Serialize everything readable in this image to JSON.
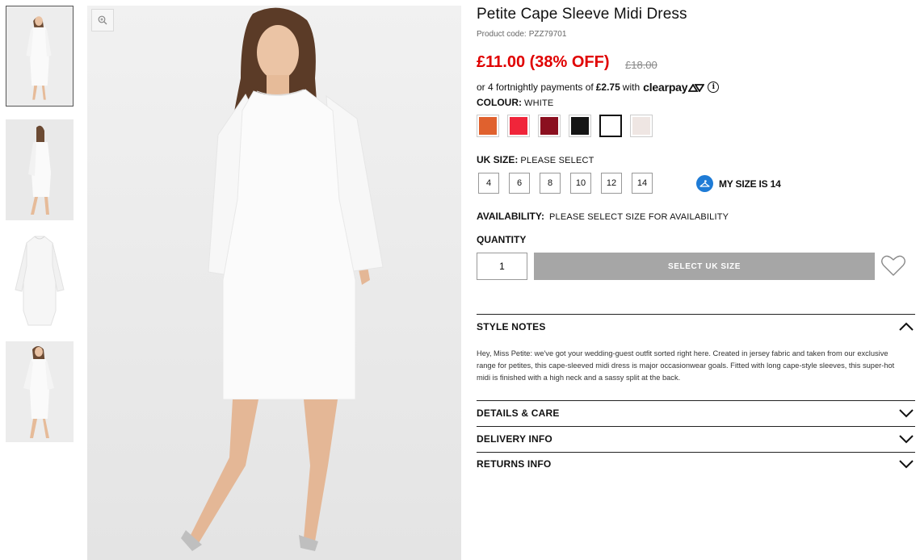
{
  "gallery": {
    "thumbnails": [
      {
        "label": "front view"
      },
      {
        "label": "side view"
      },
      {
        "label": "flat lay"
      },
      {
        "label": "full length"
      }
    ],
    "zoom_icon": "zoom-icon"
  },
  "product": {
    "title": "Petite Cape Sleeve Midi Dress",
    "code_label": "Product code:",
    "code_value": "PZZ79701",
    "price": "£11.00 (38% OFF)",
    "was_price": "£18.00",
    "clearpay": {
      "prefix": "or 4 fortnightly payments of",
      "amount": "£2.75",
      "suffix": "with",
      "logo_text": "clearpay",
      "info_icon": "info-icon"
    },
    "colour": {
      "label": "COLOUR:",
      "value": "WHITE",
      "swatches": [
        {
          "name": "orange",
          "color": "#e0612e"
        },
        {
          "name": "red",
          "color": "#f0253a"
        },
        {
          "name": "burgundy",
          "color": "#8b0f1f"
        },
        {
          "name": "black",
          "color": "#151515"
        },
        {
          "name": "white",
          "color": "#ffffff"
        },
        {
          "name": "blush",
          "color": "#efe6e3"
        }
      ],
      "selected": "white"
    },
    "size": {
      "label": "UK SIZE:",
      "value": "PLEASE SELECT",
      "options": [
        "4",
        "6",
        "8",
        "10",
        "12",
        "14"
      ],
      "my_size": "MY SIZE IS 14",
      "my_size_icon": "hanger-icon"
    },
    "availability": {
      "label": "AVAILABILITY:",
      "value": "PLEASE SELECT SIZE FOR AVAILABILITY"
    },
    "quantity": {
      "label": "QUANTITY",
      "value": "1"
    },
    "add_button": "SELECT UK SIZE",
    "wishlist_icon": "heart-icon"
  },
  "accordion": {
    "style_notes": {
      "title": "STYLE NOTES",
      "expanded": true,
      "text": "Hey, Miss Petite: we've got your wedding-guest outfit sorted right here. Created in jersey fabric and taken from our exclusive range for petites, this cape-sleeved midi dress is major occasionwear goals. Fitted with long cape-style sleeves, this super-hot midi is finished with a high neck and a sassy split at the back."
    },
    "details": {
      "title": "DETAILS & CARE"
    },
    "delivery": {
      "title": "DELIVERY INFO"
    },
    "returns": {
      "title": "RETURNS INFO"
    }
  },
  "colors": {
    "price_red": "#e00000",
    "button_grey": "#a6a6a6",
    "accent_blue": "#1e7bd6"
  }
}
